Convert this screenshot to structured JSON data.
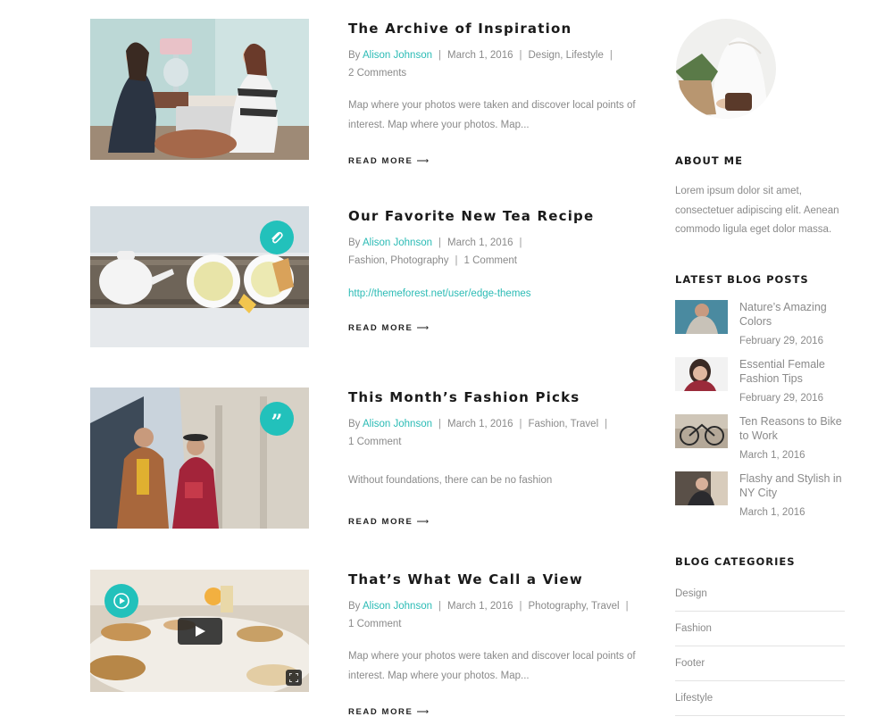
{
  "posts": [
    {
      "title": "The Archive of Inspiration",
      "by": "By",
      "author": "Alison Johnson",
      "date": "March 1, 2016",
      "categories": "Design, Lifestyle",
      "comments": "2 Comments",
      "excerpt": "Map where your photos were taken and discover local points of interest. Map where your photos. Map...",
      "read_more": "READ MORE",
      "arrow": "⟶"
    },
    {
      "title": "Our Favorite New Tea Recipe",
      "by": "By",
      "author": "Alison Johnson",
      "date": "March 1, 2016",
      "categories": "Fashion, Photography",
      "comments": "1 Comment",
      "link": "http://themeforest.net/user/edge-themes",
      "read_more": "READ MORE",
      "arrow": "⟶",
      "badge_icon": "paperclip-icon"
    },
    {
      "title": "This Month’s Fashion Picks",
      "by": "By",
      "author": "Alison Johnson",
      "date": "March 1, 2016",
      "categories": "Fashion, Travel",
      "comments": "1 Comment",
      "excerpt": "Without foundations, there can be no fashion",
      "read_more": "READ MORE",
      "arrow": "⟶",
      "badge_icon": "quote-icon"
    },
    {
      "title": "That’s What We Call a View",
      "by": "By",
      "author": "Alison Johnson",
      "date": "March 1, 2016",
      "categories": "Photography, Travel",
      "comments": "1 Comment",
      "excerpt": "Map where your photos were taken and discover local points of interest. Map where your photos. Map...",
      "read_more": "READ MORE",
      "arrow": "⟶",
      "badge_icon": "play-circle-icon"
    }
  ],
  "sidebar": {
    "about_title": "ABOUT ME",
    "about_text": "Lorem ipsum dolor sit amet, consectetuer adipiscing elit. Aenean commodo ligula eget dolor massa.",
    "latest_title": "LATEST BLOG POSTS",
    "latest": [
      {
        "title": "Nature’s Amazing Colors",
        "date": "February 29, 2016"
      },
      {
        "title": "Essential Female Fashion Tips",
        "date": "February 29, 2016"
      },
      {
        "title": "Ten Reasons to Bike to Work",
        "date": "March 1, 2016"
      },
      {
        "title": "Flashy and Stylish in NY City",
        "date": "March 1, 2016"
      }
    ],
    "categories_title": "BLOG CATEGORIES",
    "categories": [
      "Design",
      "Fashion",
      "Footer",
      "Lifestyle"
    ]
  },
  "colors": {
    "accent": "#22c1bb",
    "text": "#222222",
    "muted": "#8a8a8a"
  }
}
